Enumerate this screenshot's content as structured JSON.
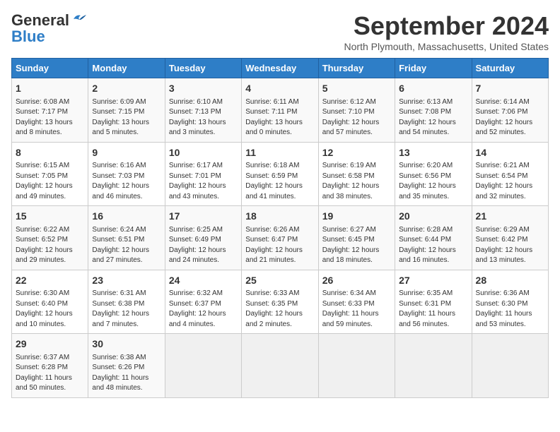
{
  "logo": {
    "general": "General",
    "blue": "Blue"
  },
  "title": "September 2024",
  "subtitle": "North Plymouth, Massachusetts, United States",
  "days_of_week": [
    "Sunday",
    "Monday",
    "Tuesday",
    "Wednesday",
    "Thursday",
    "Friday",
    "Saturday"
  ],
  "weeks": [
    [
      {
        "day": "1",
        "sunrise": "6:08 AM",
        "sunset": "7:17 PM",
        "daylight": "13 hours and 8 minutes."
      },
      {
        "day": "2",
        "sunrise": "6:09 AM",
        "sunset": "7:15 PM",
        "daylight": "13 hours and 5 minutes."
      },
      {
        "day": "3",
        "sunrise": "6:10 AM",
        "sunset": "7:13 PM",
        "daylight": "13 hours and 3 minutes."
      },
      {
        "day": "4",
        "sunrise": "6:11 AM",
        "sunset": "7:11 PM",
        "daylight": "13 hours and 0 minutes."
      },
      {
        "day": "5",
        "sunrise": "6:12 AM",
        "sunset": "7:10 PM",
        "daylight": "12 hours and 57 minutes."
      },
      {
        "day": "6",
        "sunrise": "6:13 AM",
        "sunset": "7:08 PM",
        "daylight": "12 hours and 54 minutes."
      },
      {
        "day": "7",
        "sunrise": "6:14 AM",
        "sunset": "7:06 PM",
        "daylight": "12 hours and 52 minutes."
      }
    ],
    [
      {
        "day": "8",
        "sunrise": "6:15 AM",
        "sunset": "7:05 PM",
        "daylight": "12 hours and 49 minutes."
      },
      {
        "day": "9",
        "sunrise": "6:16 AM",
        "sunset": "7:03 PM",
        "daylight": "12 hours and 46 minutes."
      },
      {
        "day": "10",
        "sunrise": "6:17 AM",
        "sunset": "7:01 PM",
        "daylight": "12 hours and 43 minutes."
      },
      {
        "day": "11",
        "sunrise": "6:18 AM",
        "sunset": "6:59 PM",
        "daylight": "12 hours and 41 minutes."
      },
      {
        "day": "12",
        "sunrise": "6:19 AM",
        "sunset": "6:58 PM",
        "daylight": "12 hours and 38 minutes."
      },
      {
        "day": "13",
        "sunrise": "6:20 AM",
        "sunset": "6:56 PM",
        "daylight": "12 hours and 35 minutes."
      },
      {
        "day": "14",
        "sunrise": "6:21 AM",
        "sunset": "6:54 PM",
        "daylight": "12 hours and 32 minutes."
      }
    ],
    [
      {
        "day": "15",
        "sunrise": "6:22 AM",
        "sunset": "6:52 PM",
        "daylight": "12 hours and 29 minutes."
      },
      {
        "day": "16",
        "sunrise": "6:24 AM",
        "sunset": "6:51 PM",
        "daylight": "12 hours and 27 minutes."
      },
      {
        "day": "17",
        "sunrise": "6:25 AM",
        "sunset": "6:49 PM",
        "daylight": "12 hours and 24 minutes."
      },
      {
        "day": "18",
        "sunrise": "6:26 AM",
        "sunset": "6:47 PM",
        "daylight": "12 hours and 21 minutes."
      },
      {
        "day": "19",
        "sunrise": "6:27 AM",
        "sunset": "6:45 PM",
        "daylight": "12 hours and 18 minutes."
      },
      {
        "day": "20",
        "sunrise": "6:28 AM",
        "sunset": "6:44 PM",
        "daylight": "12 hours and 16 minutes."
      },
      {
        "day": "21",
        "sunrise": "6:29 AM",
        "sunset": "6:42 PM",
        "daylight": "12 hours and 13 minutes."
      }
    ],
    [
      {
        "day": "22",
        "sunrise": "6:30 AM",
        "sunset": "6:40 PM",
        "daylight": "12 hours and 10 minutes."
      },
      {
        "day": "23",
        "sunrise": "6:31 AM",
        "sunset": "6:38 PM",
        "daylight": "12 hours and 7 minutes."
      },
      {
        "day": "24",
        "sunrise": "6:32 AM",
        "sunset": "6:37 PM",
        "daylight": "12 hours and 4 minutes."
      },
      {
        "day": "25",
        "sunrise": "6:33 AM",
        "sunset": "6:35 PM",
        "daylight": "12 hours and 2 minutes."
      },
      {
        "day": "26",
        "sunrise": "6:34 AM",
        "sunset": "6:33 PM",
        "daylight": "11 hours and 59 minutes."
      },
      {
        "day": "27",
        "sunrise": "6:35 AM",
        "sunset": "6:31 PM",
        "daylight": "11 hours and 56 minutes."
      },
      {
        "day": "28",
        "sunrise": "6:36 AM",
        "sunset": "6:30 PM",
        "daylight": "11 hours and 53 minutes."
      }
    ],
    [
      {
        "day": "29",
        "sunrise": "6:37 AM",
        "sunset": "6:28 PM",
        "daylight": "11 hours and 50 minutes."
      },
      {
        "day": "30",
        "sunrise": "6:38 AM",
        "sunset": "6:26 PM",
        "daylight": "11 hours and 48 minutes."
      },
      null,
      null,
      null,
      null,
      null
    ]
  ],
  "labels": {
    "sunrise": "Sunrise:",
    "sunset": "Sunset:",
    "daylight": "Daylight:"
  }
}
